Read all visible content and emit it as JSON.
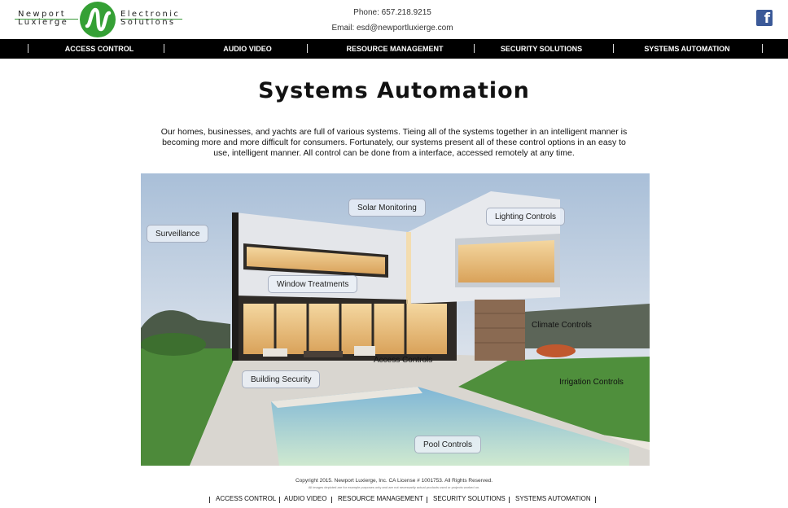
{
  "header": {
    "logo": {
      "left_words": [
        "Newport",
        "Luxierge"
      ],
      "right_words": [
        "Electronic",
        "Solutions"
      ],
      "brand_color": "#35a035"
    },
    "phone": "Phone: 657.218.9215",
    "email": "Email: esd@newportluxierge.com",
    "social": {
      "icon": "facebook-icon",
      "glyph": "f"
    }
  },
  "nav": {
    "items": [
      "ACCESS CONTROL",
      "AUDIO VIDEO",
      "RESOURCE MANAGEMENT",
      "SECURITY SOLUTIONS",
      "SYSTEMS AUTOMATION"
    ]
  },
  "main": {
    "title": "Systems Automation",
    "intro": "Our homes, businesses, and yachts are full of various systems. Tieing all of the systems together in an intelligent manner is becoming more and more difficult for consumers. Fortunately, our systems present all of these control options in an easy to use, intelligent manner. All control can be done from a interface, accessed remotely at any time.",
    "callouts": {
      "surveillance": "Surveillance",
      "solar": "Solar Monitoring",
      "lighting": "Lighting Controls",
      "window": "Window Treatments",
      "climate": "Climate Controls",
      "access": "Access Controls",
      "building": "Building Security",
      "irrigation": "Irrigation Controls",
      "pool": "Pool Controls"
    }
  },
  "footer": {
    "copyright": "Copyright 2015. Newport Luxierge, Inc. CA License # 1001753. All Rights Reserved.",
    "disclaimer": "All images depicted are for example purposes only and are not necessarily actual products used or projects worked on.",
    "links": [
      "ACCESS CONTROL",
      "AUDIO VIDEO",
      "RESOURCE MANAGEMENT",
      "SECURITY SOLUTIONS",
      "SYSTEMS AUTOMATION"
    ]
  }
}
